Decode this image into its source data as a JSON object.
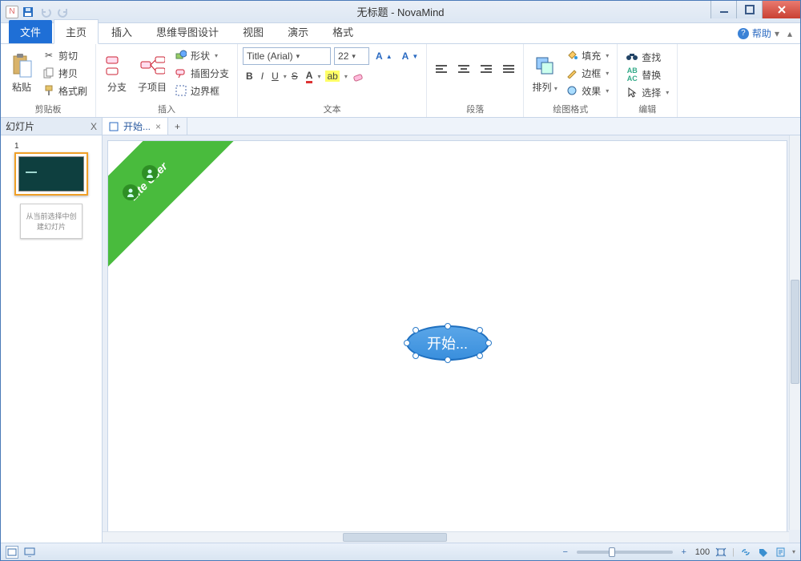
{
  "window": {
    "title": "无标题 - NovaMind"
  },
  "tabs": {
    "file": "文件",
    "home": "主页",
    "insert": "插入",
    "design": "思维导图设计",
    "view": "视图",
    "present": "演示",
    "format": "格式",
    "help": "帮助"
  },
  "ribbon": {
    "clipboard": {
      "paste": "粘贴",
      "cut": "剪切",
      "copy": "拷贝",
      "format_painter": "格式刷",
      "label": "剪贴板"
    },
    "insert": {
      "subtopic": "分支",
      "child": "子项目",
      "shape": "形状",
      "callout": "插图分支",
      "border": "边界框",
      "label": "插入"
    },
    "text": {
      "font_name": "Title (Arial)",
      "font_size": "22",
      "label": "文本"
    },
    "paragraph": {
      "label": "段落"
    },
    "arrange": {
      "arrange": "排列",
      "fill": "填充",
      "outline": "边框",
      "effects": "效果",
      "label": "绘图格式"
    },
    "editing": {
      "find": "查找",
      "replace": "替换",
      "select": "选择",
      "label": "编辑"
    }
  },
  "sidepanel": {
    "title": "幻灯片",
    "slide_num": "1",
    "new_hint": "从当前选择中创建幻灯片"
  },
  "doctab": {
    "name": "开始..."
  },
  "canvas": {
    "badge": "Lite User",
    "node_text": "开始..."
  },
  "status": {
    "zoom": "100"
  }
}
